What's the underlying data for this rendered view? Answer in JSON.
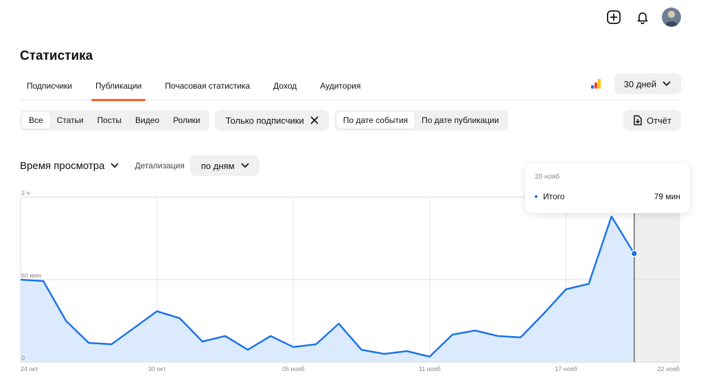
{
  "header": {
    "icons": [
      "add-icon",
      "bell-icon",
      "avatar"
    ]
  },
  "page_title": "Статистика",
  "tabs": [
    {
      "label": "Подписчики",
      "active": false
    },
    {
      "label": "Публикации",
      "active": true
    },
    {
      "label": "Почасовая статистика",
      "active": false
    },
    {
      "label": "Доход",
      "active": false
    },
    {
      "label": "Аудитория",
      "active": false
    }
  ],
  "period": {
    "label": "30 дней"
  },
  "filters": {
    "content_types": [
      "Все",
      "Статьи",
      "Посты",
      "Видео",
      "Ролики"
    ],
    "content_type_selected": "Все",
    "subscribers_chip": "Только подписчики",
    "date_modes": [
      "По дате события",
      "По дате публикации"
    ],
    "date_mode_selected": "По дате события"
  },
  "report_button": "Отчёт",
  "metric": {
    "label": "Время просмотра",
    "detail_label": "Детализация",
    "detail_value": "по дням"
  },
  "tooltip": {
    "date": "20 нояб",
    "series": "Итого",
    "value": "79 мин"
  },
  "colors": {
    "accent": "#ff5a1f",
    "line": "#1a73e8",
    "area": "#dbeafc"
  },
  "chart_data": {
    "type": "area",
    "ylabels": [
      "2 ч",
      "60 мин",
      "0"
    ],
    "ylim": [
      0,
      120
    ],
    "xlabels": [
      "24 окт",
      "30 окт",
      "05 нояб",
      "11 нояб",
      "17 нояб",
      "22 нояб"
    ],
    "x": [
      "24 окт",
      "25 окт",
      "26 окт",
      "27 окт",
      "28 окт",
      "29 окт",
      "30 окт",
      "31 окт",
      "01 нояб",
      "02 нояб",
      "03 нояб",
      "04 нояб",
      "05 нояб",
      "06 нояб",
      "07 нояб",
      "08 нояб",
      "09 нояб",
      "10 нояб",
      "11 нояб",
      "12 нояб",
      "13 нояб",
      "14 нояб",
      "15 нояб",
      "16 нояб",
      "17 нояб",
      "18 нояб",
      "19 нояб",
      "20 нояб"
    ],
    "series": [
      {
        "name": "Итого",
        "values": [
          60,
          59,
          30,
          14,
          13,
          25,
          37,
          32,
          15,
          19,
          9,
          19,
          11,
          13,
          28,
          9,
          6,
          8,
          4,
          20,
          23,
          19,
          18,
          35,
          53,
          57,
          106,
          79
        ]
      }
    ],
    "highlighted": "20 нояб",
    "grid": true
  }
}
